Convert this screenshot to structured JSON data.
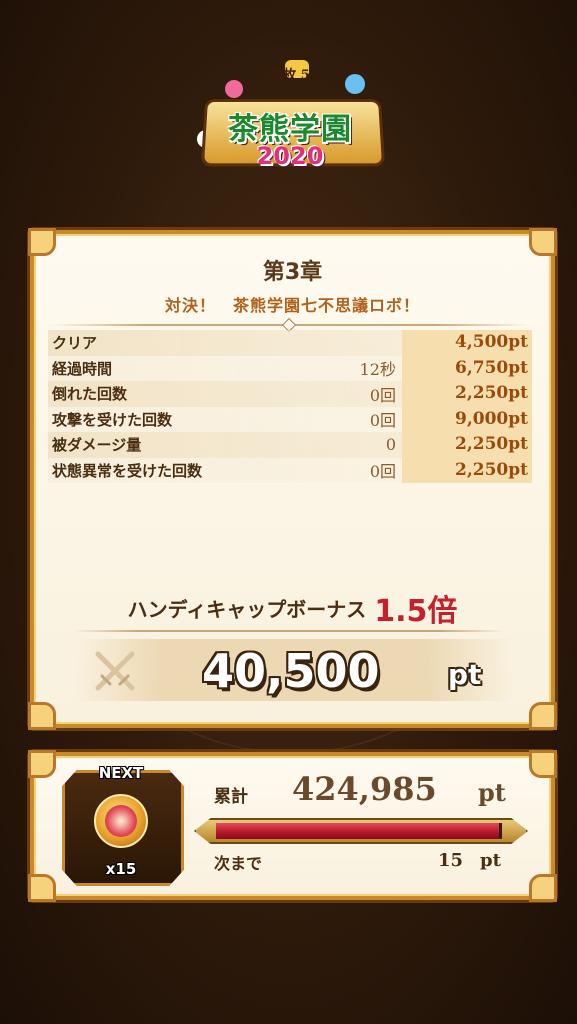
{
  "event_logo": {
    "small_text": "四枚 5",
    "title": "茶熊学園",
    "year": "2020"
  },
  "result": {
    "chapter": "第3章",
    "subtitle": "対決！　茶熊学園七不思議ロボ！",
    "rows": [
      {
        "label": "クリア",
        "value": "",
        "points": "4,500pt"
      },
      {
        "label": "経過時間",
        "value": "12秒",
        "points": "6,750pt"
      },
      {
        "label": "倒れた回数",
        "value": "0回",
        "points": "2,250pt"
      },
      {
        "label": "攻撃を受けた回数",
        "value": "0回",
        "points": "9,000pt"
      },
      {
        "label": "被ダメージ量",
        "value": "0",
        "points": "2,250pt"
      },
      {
        "label": "状態異常を受けた回数",
        "value": "0回",
        "points": "2,250pt"
      }
    ],
    "bonus_label": "ハンディキャップボーナス",
    "bonus_multiplier": "1.5倍",
    "total_score": "40,500",
    "total_unit": "pt"
  },
  "next_reward": {
    "tag": "NEXT",
    "count": "x15",
    "cumulative_label": "累計",
    "cumulative_value": "424,985",
    "cumulative_unit": "pt",
    "progress_fraction": 0.99,
    "remaining_label": "次まで",
    "remaining_value": "15",
    "remaining_unit": "pt"
  },
  "colors": {
    "panel_border": "#c98a2a",
    "bonus_red": "#c8202a",
    "progress_red": "#b01828"
  }
}
